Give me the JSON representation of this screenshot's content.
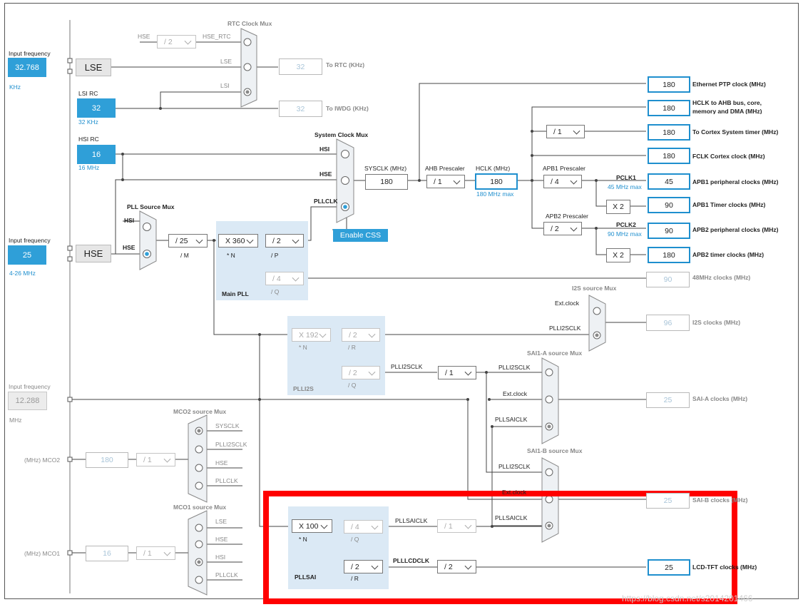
{
  "inputs": {
    "lse_heading": "Input frequency",
    "lse_value": "32.768",
    "lse_unit": "KHz",
    "lse_name": "LSE",
    "lsi_heading": "LSI RC",
    "lsi_value": "32",
    "lsi_unit": "32 KHz",
    "hsi_heading": "HSI RC",
    "hsi_value": "16",
    "hsi_unit": "16 MHz",
    "hse_heading": "Input frequency",
    "hse_value": "25",
    "hse_unit": "4-26 MHz",
    "hse_name": "HSE",
    "ext_heading": "Input frequency",
    "ext_value": "12.288",
    "ext_unit": "MHz"
  },
  "rtc": {
    "title": "RTC Clock Mux",
    "hse_label": "HSE",
    "div": "/ 2",
    "hse_rtc_label": "HSE_RTC",
    "lse_label": "LSE",
    "lsi_label": "LSI",
    "out_value": "32",
    "out_label": "To RTC (KHz)",
    "iwdg_value": "32",
    "iwdg_label": "To IWDG (KHz)"
  },
  "sysmux": {
    "title": "System Clock Mux",
    "hsi": "HSI",
    "hse": "HSE",
    "pllclk": "PLLCLK",
    "enable_css": "Enable CSS",
    "sysclk_label": "SYSCLK (MHz)",
    "sysclk_value": "180"
  },
  "ahb": {
    "prescaler_label": "AHB Prescaler",
    "prescaler": "/ 1",
    "hclk_label": "HCLK (MHz)",
    "hclk_value": "180",
    "hclk_max": "180 MHz max"
  },
  "pll_source": {
    "title": "PLL Source Mux",
    "hsi": "HSI",
    "hse": "HSE",
    "m_div": "/ 25",
    "m_label": "/ M"
  },
  "main_pll": {
    "title": "Main PLL",
    "n_mul": "X 360",
    "n_label": "* N",
    "p_div": "/ 2",
    "p_label": "/ P",
    "q_div": "/ 4",
    "q_label": "/ Q"
  },
  "outputs": {
    "eth_value": "180",
    "eth_label": "Ethernet PTP clock (MHz)",
    "hclk_bus_value": "180",
    "hclk_bus_label_1": "HCLK to AHB bus, core,",
    "hclk_bus_label_2": "memory and DMA (MHz)",
    "cortex_div": "/ 1",
    "cortex_value": "180",
    "cortex_label": "To Cortex System timer (MHz)",
    "fclk_value": "180",
    "fclk_label": "FCLK Cortex clock (MHz)",
    "apb1_prescaler_label": "APB1 Prescaler",
    "apb1_prescaler": "/ 4",
    "pclk1_label": "PCLK1",
    "pclk1_max": "45 MHz max",
    "apb1_value": "45",
    "apb1_label": "APB1 peripheral clocks (MHz)",
    "apb1_timer_mul": "X 2",
    "apb1_timer_value": "90",
    "apb1_timer_label": "APB1 Timer clocks (MHz)",
    "apb2_prescaler_label": "APB2 Prescaler",
    "apb2_prescaler": "/ 2",
    "pclk2_label": "PCLK2",
    "pclk2_max": "90 MHz max",
    "apb2_value": "90",
    "apb2_label": "APB2 peripheral clocks (MHz)",
    "apb2_timer_mul": "X 2",
    "apb2_timer_value": "180",
    "apb2_timer_label": "APB2 timer clocks (MHz)",
    "usb48_value": "90",
    "usb48_label": "48MHz clocks (MHz)"
  },
  "i2s": {
    "title": "I2S source Mux",
    "ext": "Ext.clock",
    "plli2sclk": "PLLI2SCLK",
    "value": "96",
    "label": "I2S clocks (MHz)"
  },
  "plli2s": {
    "title": "PLLI2S",
    "n_mul": "X 192",
    "n_label": "* N",
    "r_div": "/ 2",
    "r_label": "/ R",
    "q_div": "/ 2",
    "q_label": "/ Q",
    "q_out_label": "PLLI2SCLK",
    "q_post_div": "/ 1"
  },
  "sai_a": {
    "title": "SAI1-A source Mux",
    "plli2sclk": "PLLI2SCLK",
    "ext": "Ext.clock",
    "pllsaiclk": "PLLSAICLK",
    "value": "25",
    "label": "SAI-A clocks (MHz)"
  },
  "sai_b": {
    "title": "SAI1-B source Mux",
    "plli2sclk": "PLLI2SCLK",
    "ext": "Ext.clock",
    "pllsaiclk": "PLLSAICLK",
    "value": "25",
    "label": "SAI-B clocks (MHz)"
  },
  "mco2": {
    "title": "MCO2 source Mux",
    "sysclk": "SYSCLK",
    "plli2sclk": "PLLI2SCLK",
    "hse": "HSE",
    "pllclk": "PLLCLK",
    "div": "/ 1",
    "value": "180",
    "label": "(MHz) MCO2"
  },
  "mco1": {
    "title": "MCO1 source Mux",
    "lse": "LSE",
    "hse": "HSE",
    "hsi": "HSI",
    "pllclk": "PLLCLK",
    "div": "/ 1",
    "value": "16",
    "label": "(MHz) MCO1"
  },
  "pllsai": {
    "title": "PLLSAI",
    "n_mul": "X 100",
    "n_label": "* N",
    "q_div": "/ 4",
    "q_label": "/ Q",
    "q_out_label": "PLLSAICLK",
    "q_post_div": "/ 1",
    "r_div": "/ 2",
    "r_label": "/ R",
    "r_out_label": "PLLLCDCLK",
    "r_post_div": "/ 2"
  },
  "lcd": {
    "value": "25",
    "label": "LCD-TFT clocks (MHz)"
  },
  "watermark": "https://blog.csdn.net/s2014201466",
  "colors": {
    "accent": "#2f9fd8",
    "highlight": "#ff0000",
    "pll_bg": "#dbe9f5"
  }
}
